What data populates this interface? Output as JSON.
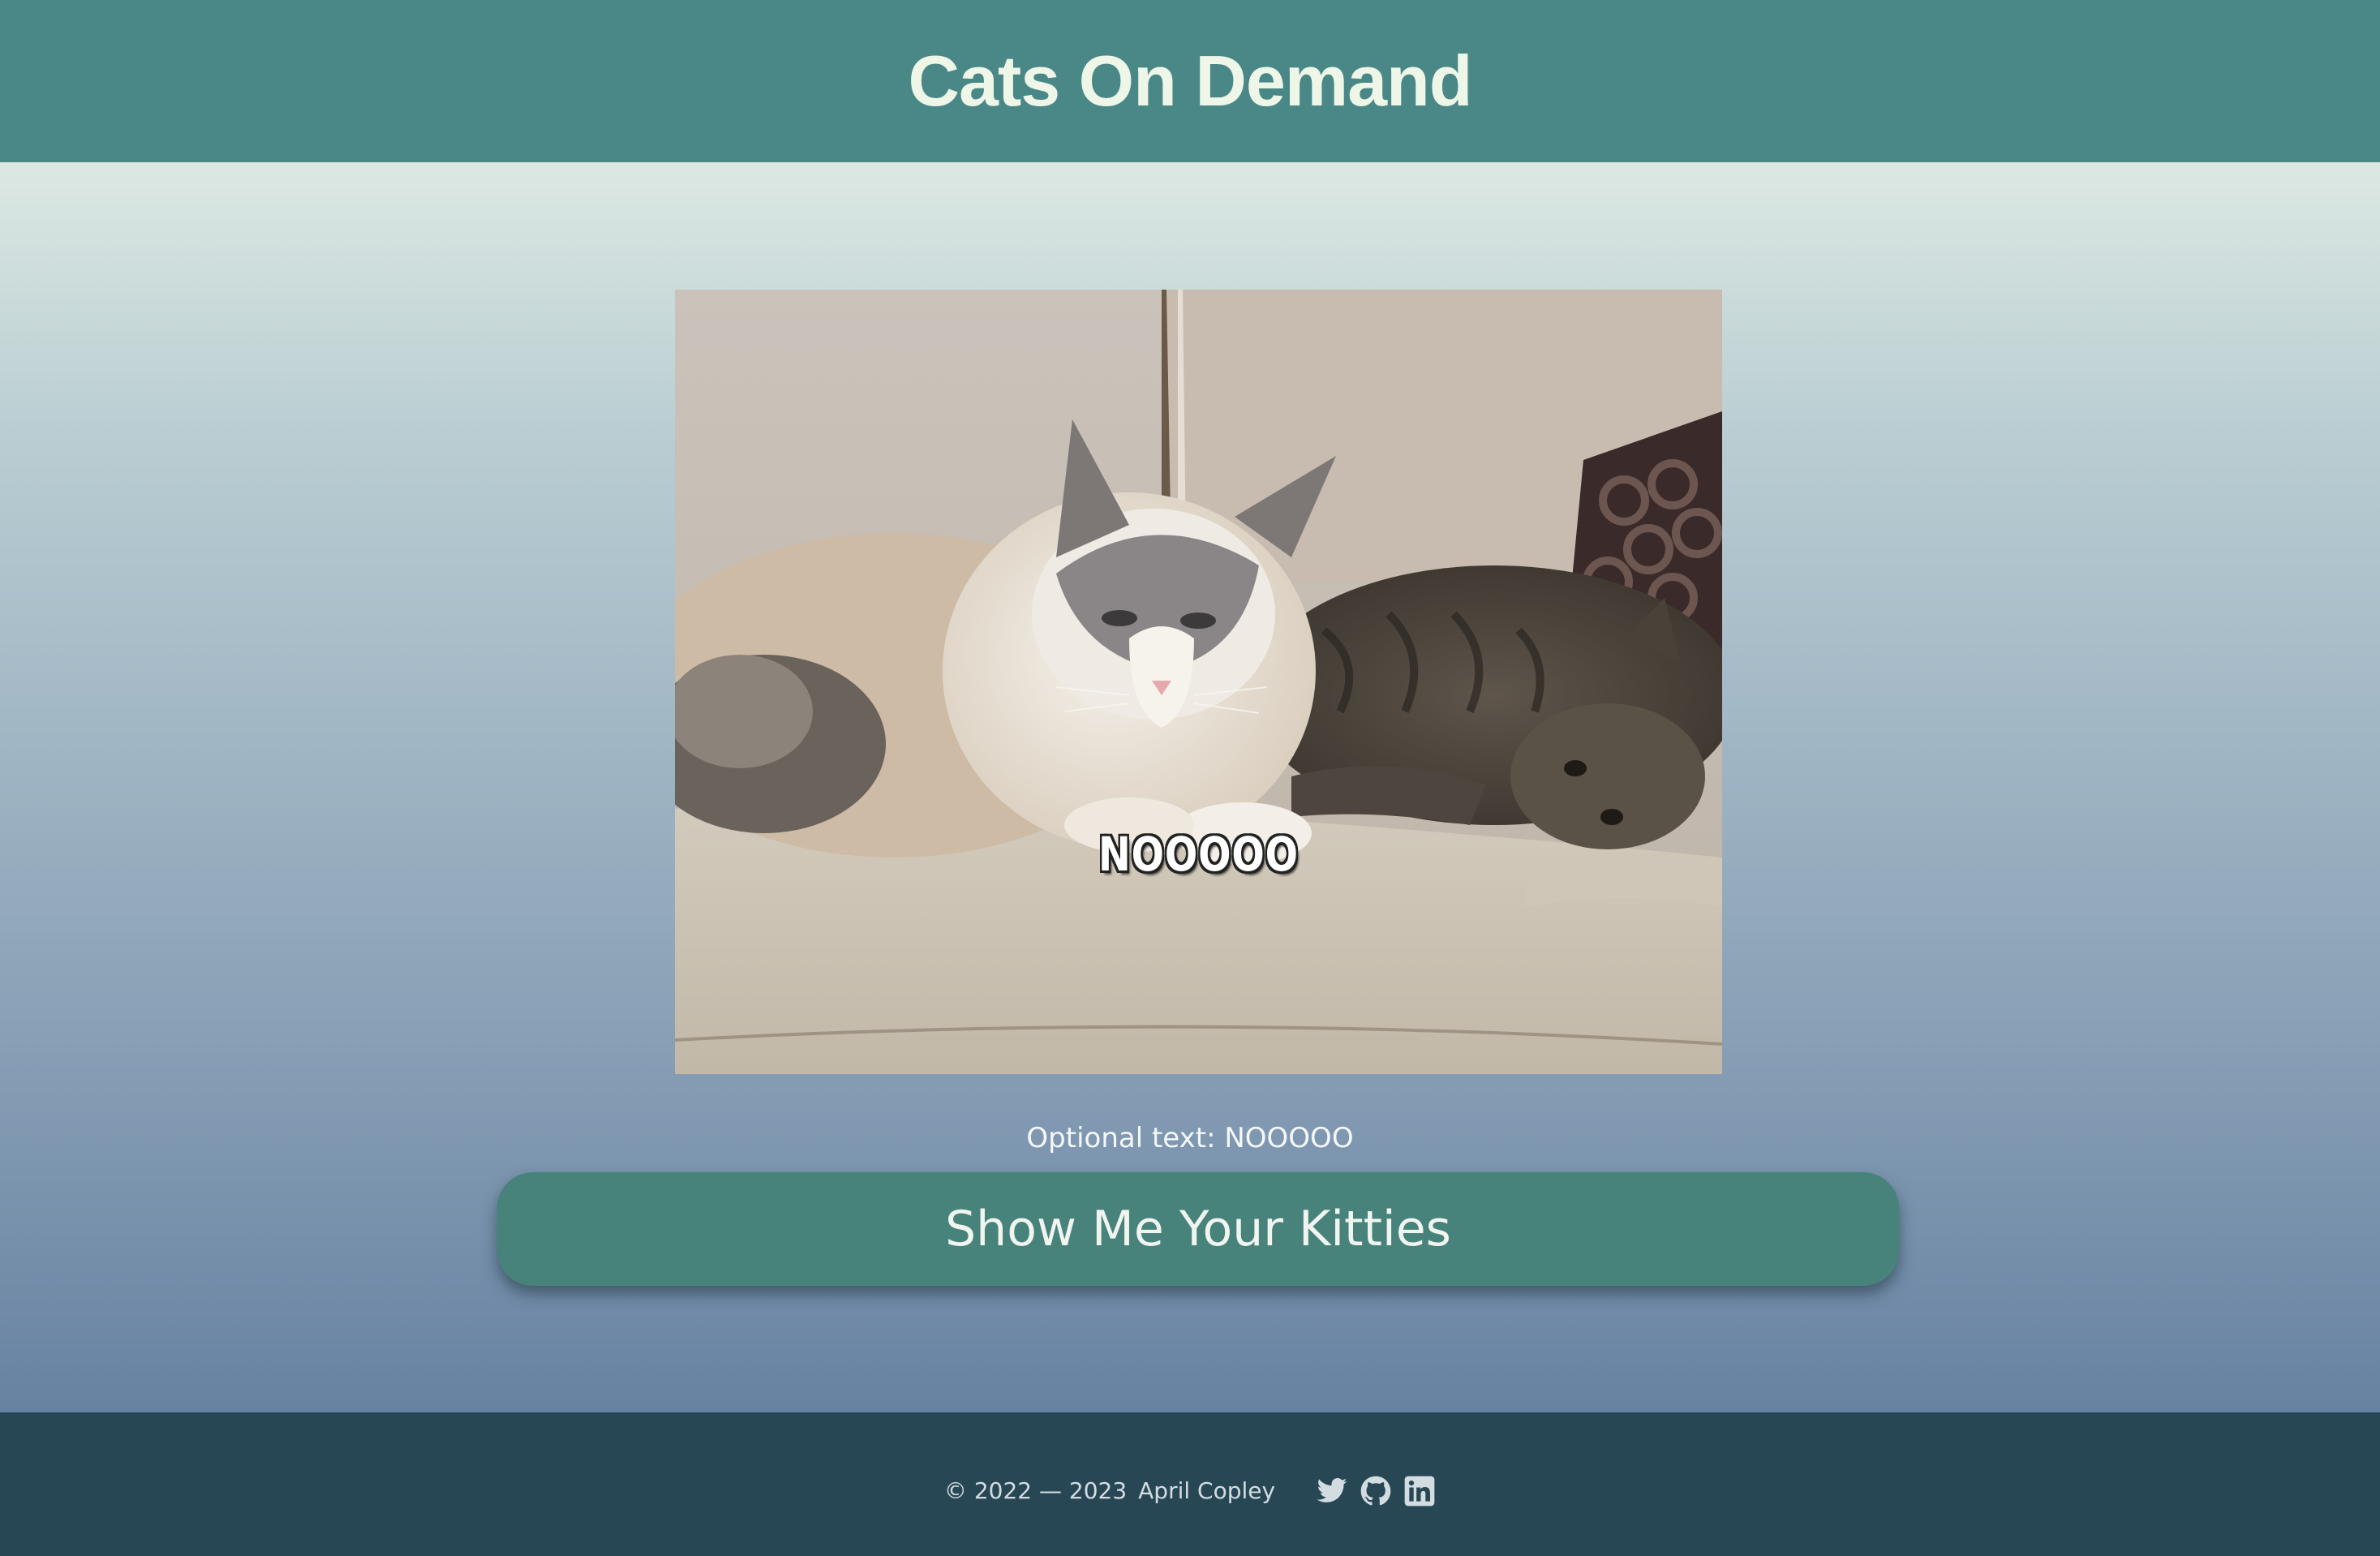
{
  "header": {
    "title": "Cats On Demand"
  },
  "main": {
    "image": {
      "meme_text": "NOOOOO",
      "subject": "two cats on a beige couch"
    },
    "optional_text": "Optional text: NOOOOO",
    "button_label": "Show Me Your Kitties"
  },
  "footer": {
    "copyright": "© 2022 — 2023",
    "author": "April Copley",
    "social": [
      {
        "icon": "twitter-icon"
      },
      {
        "icon": "github-icon"
      },
      {
        "icon": "linkedin-icon"
      }
    ]
  },
  "colors": {
    "header_bg": "#4a8888",
    "title_text": "#eef6e8",
    "button_bg": "#47837b",
    "footer_bg": "#284755",
    "gradient_top": "#dce8e3",
    "gradient_bottom": "#6782a2"
  }
}
